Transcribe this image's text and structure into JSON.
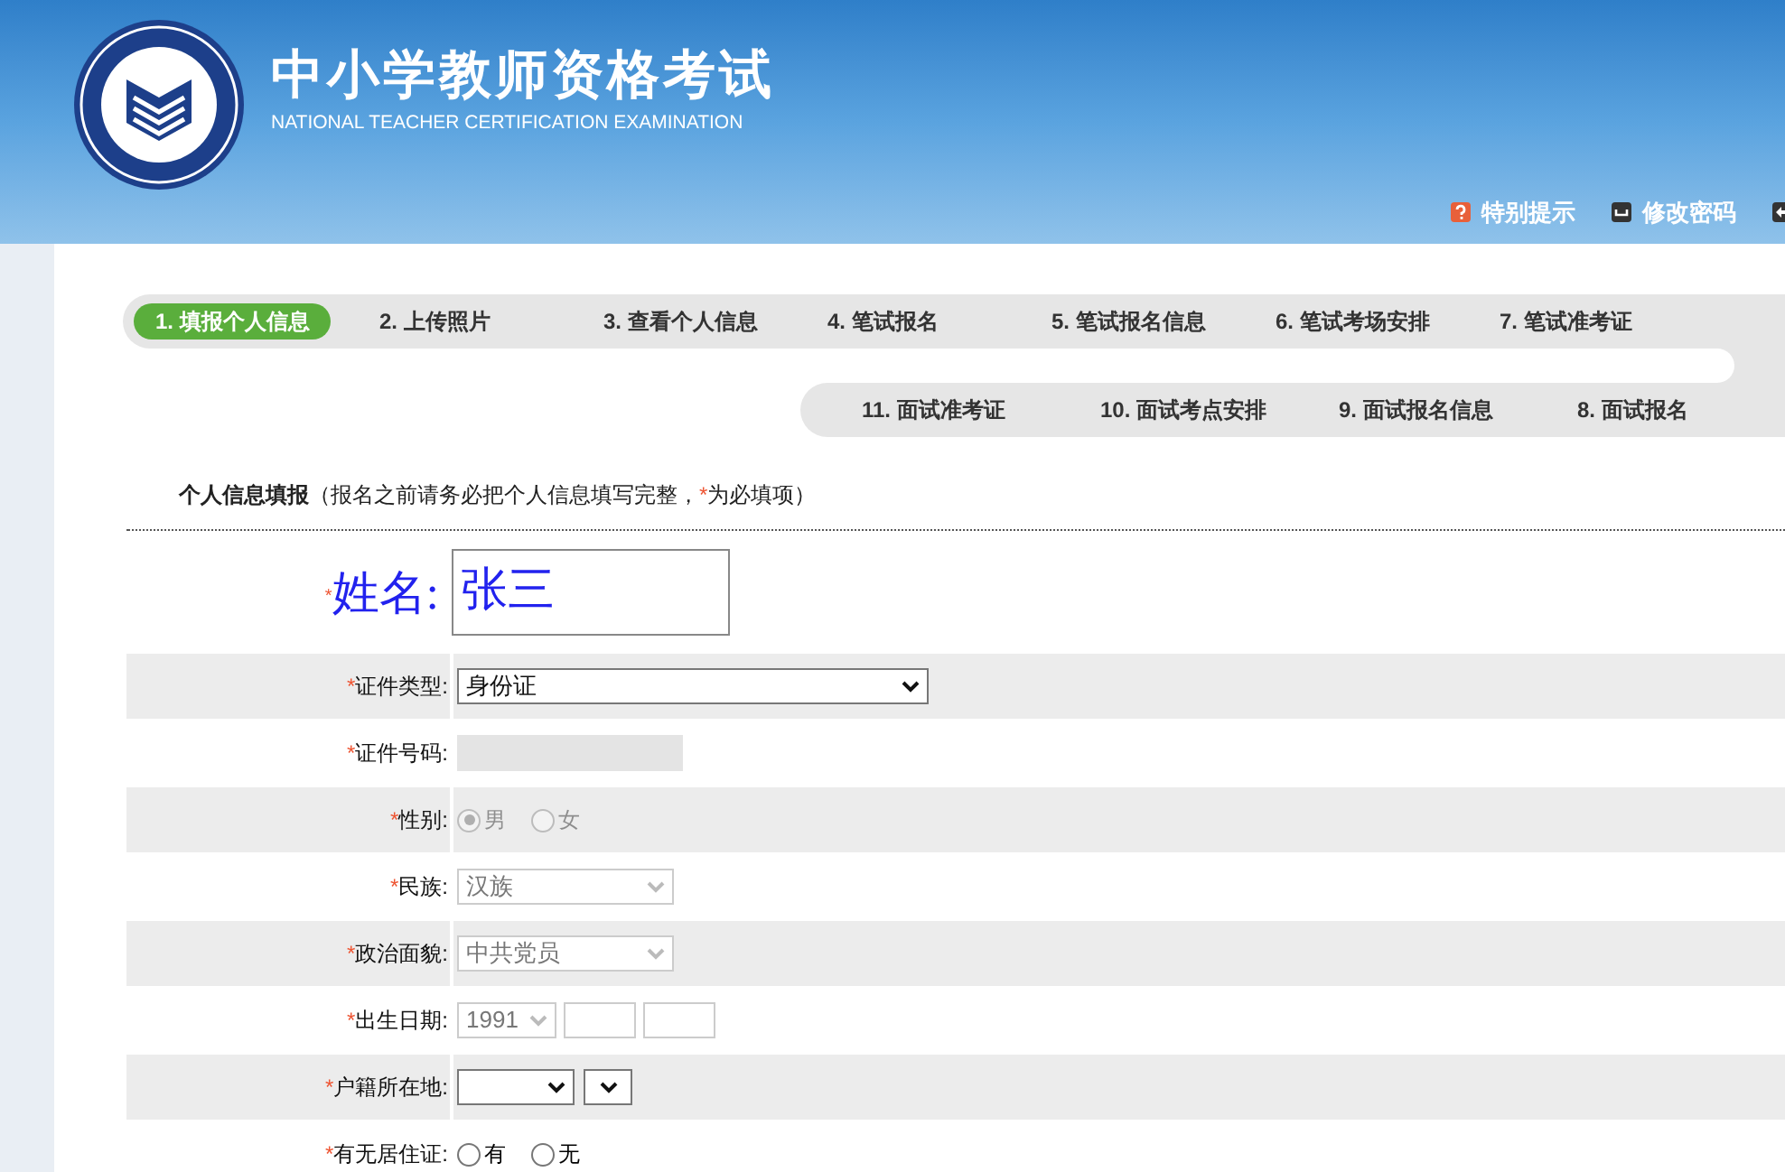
{
  "header": {
    "title": "中小学教师资格考试",
    "subtitle": "NATIONAL TEACHER CERTIFICATION EXAMINATION",
    "links": [
      {
        "kind": "help",
        "label": "特别提示"
      },
      {
        "kind": "password",
        "label": "修改密码"
      },
      {
        "kind": "logout"
      }
    ]
  },
  "steps_row1": [
    {
      "label": "1. 填报个人信息",
      "selected": true
    },
    {
      "label": "2. 上传照片",
      "selected": false
    },
    {
      "label": "3. 查看个人信息",
      "selected": false
    },
    {
      "label": "4. 笔试报名",
      "selected": false
    },
    {
      "label": "5. 笔试报名信息",
      "selected": false
    },
    {
      "label": "6. 笔试考场安排",
      "selected": false
    },
    {
      "label": "7. 笔试准考证",
      "selected": false
    }
  ],
  "steps_row2": [
    {
      "label": "11. 面试准考证",
      "selected": false
    },
    {
      "label": "10. 面试考点安排",
      "selected": false
    },
    {
      "label": "9. 面试报名信息",
      "selected": false
    },
    {
      "label": "8. 面试报名",
      "selected": false
    }
  ],
  "section": {
    "title": "个人信息填报",
    "note_before": "（报名之前请务必把个人信息填写完整，",
    "required_mark": "*",
    "note_after": "为必填项）"
  },
  "name_field": {
    "label": "姓名:",
    "value": "张三"
  },
  "rows": [
    {
      "kind": "select",
      "label": "证件类型:",
      "value": "身份证",
      "blurred": false
    },
    {
      "kind": "text",
      "label": "证件号码:",
      "blurred": true
    },
    {
      "kind": "radio",
      "label": "性别:",
      "options": [
        {
          "label": "男",
          "selected": true
        },
        {
          "label": "女",
          "selected": false
        }
      ],
      "blurred": true
    },
    {
      "kind": "select",
      "label": "民族:",
      "value": "汉族",
      "blurred": true
    },
    {
      "kind": "select",
      "label": "政治面貌:",
      "value": "中共党员",
      "blurred": true
    },
    {
      "kind": "date",
      "label": "出生日期:",
      "value": "1991",
      "blurred": true
    },
    {
      "kind": "region",
      "label": "户籍所在地:",
      "blurred": false
    },
    {
      "kind": "radio",
      "label": "有无居住证:",
      "options": [
        {
          "label": "有",
          "selected": false
        },
        {
          "label": "无",
          "selected": false
        }
      ],
      "blurred": false
    }
  ]
}
